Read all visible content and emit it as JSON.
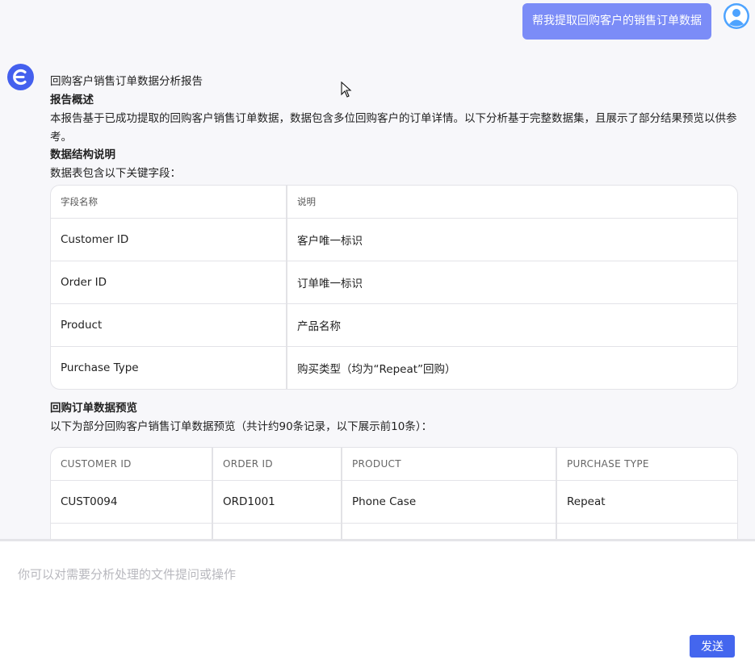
{
  "user_message": "帮我提取回购客户的销售订单数据",
  "report": {
    "title": "回购客户销售订单数据分析报告",
    "overview_heading": "报告概述",
    "overview_text": "本报告基于已成功提取的回购客户销售订单数据，数据包含多位回购客户的订单详情。以下分析基于完整数据集，且展示了部分结果预览以供参考。",
    "structure_heading": "数据结构说明",
    "structure_intro": "数据表包含以下关键字段：",
    "fields_table": {
      "headers": [
        "字段名称",
        "说明"
      ],
      "rows": [
        [
          "Customer ID",
          "客户唯一标识"
        ],
        [
          "Order ID",
          "订单唯一标识"
        ],
        [
          "Product",
          "产品名称"
        ],
        [
          "Purchase Type",
          "购买类型（均为“Repeat”回购）"
        ]
      ]
    },
    "preview_heading": "回购订单数据预览",
    "preview_intro": "以下为部分回购客户销售订单数据预览（共计约90条记录，以下展示前10条）：",
    "preview_table": {
      "headers": [
        "CUSTOMER ID",
        "ORDER ID",
        "PRODUCT",
        "PURCHASE TYPE"
      ],
      "rows": [
        [
          "CUST0094",
          "ORD1001",
          "Phone Case",
          "Repeat"
        ],
        [
          "",
          "",
          "",
          ""
        ]
      ]
    }
  },
  "input": {
    "placeholder": "你可以对需要分析处理的文件提问或操作",
    "send_label": "发送"
  },
  "colors": {
    "user_bubble": "#7b8cf7",
    "bot_avatar": "#4460ee",
    "send_button": "#4466ee"
  },
  "icons": {
    "bot_avatar": "bot-logo-icon",
    "user_avatar": "user-avatar-icon",
    "cursor": "mouse-cursor-icon"
  }
}
